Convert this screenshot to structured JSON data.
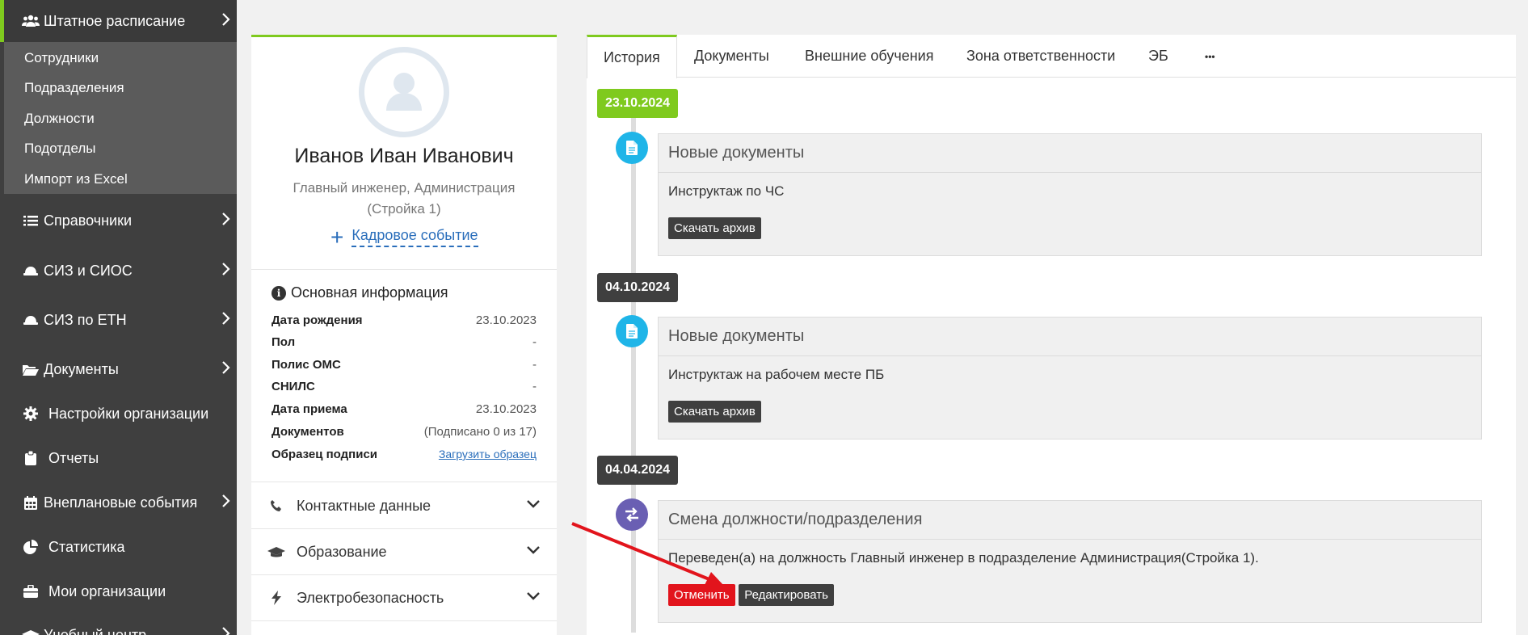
{
  "sidebar": {
    "items": [
      {
        "label": "Штатное расписание",
        "icon": "users-icon"
      },
      {
        "label": "Справочники",
        "icon": "list-icon"
      },
      {
        "label": "СИЗ и СИОС",
        "icon": "helmet-icon"
      },
      {
        "label": "СИЗ по ЕТН",
        "icon": "helmet-icon"
      },
      {
        "label": "Документы",
        "icon": "folder-open-icon"
      },
      {
        "label": "Настройки организации",
        "icon": "gear-icon"
      },
      {
        "label": "Отчеты",
        "icon": "clipboard-icon"
      },
      {
        "label": "Внеплановые события",
        "icon": "calendar-icon"
      },
      {
        "label": "Статистика",
        "icon": "pie-chart-icon"
      },
      {
        "label": "Мои организации",
        "icon": "briefcase-icon"
      },
      {
        "label": "Учебный центр",
        "icon": "graduation-cap-icon"
      }
    ],
    "submenu": [
      "Сотрудники",
      "Подразделения",
      "Должности",
      "Подотделы",
      "Импорт из Excel"
    ]
  },
  "profile": {
    "name": "Иванов Иван Иванович",
    "position": "Главный инженер, Администрация (Стройка 1)",
    "hr_event": "Кадровое событие",
    "info_title": "Основная информация",
    "rows": [
      {
        "k": "Дата рождения",
        "v": "23.10.2023"
      },
      {
        "k": "Пол",
        "v": "-"
      },
      {
        "k": "Полис ОМС",
        "v": "-"
      },
      {
        "k": "СНИЛС",
        "v": "-"
      },
      {
        "k": "Дата приема",
        "v": "23.10.2023"
      },
      {
        "k": "Документов",
        "v": "(Подписано 0 из 17)"
      },
      {
        "k": "Образец подписи",
        "v": "Загрузить образец"
      }
    ],
    "accordions": [
      {
        "label": "Контактные данные",
        "icon": "phone-icon"
      },
      {
        "label": "Образование",
        "icon": "graduation-cap-icon"
      },
      {
        "label": "Электробезопасность",
        "icon": "bolt-icon"
      }
    ]
  },
  "tabs": [
    "История",
    "Документы",
    "Внешние обучения",
    "Зона ответственности",
    "ЭБ",
    "•••"
  ],
  "timeline": [
    {
      "date": "23.10.2024",
      "title": "Новые документы",
      "text": "Инструктаж по ЧС",
      "button": "Скачать архив"
    },
    {
      "date": "04.10.2024",
      "title": "Новые документы",
      "text": "Инструктаж на рабочем месте ПБ",
      "button": "Скачать архив"
    },
    {
      "date": "04.04.2024",
      "title": "Смена должности/подразделения",
      "text": "Переведен(а) на должность Главный инженер в подразделение Администрация(Стройка 1).",
      "cancel": "Отменить",
      "edit": "Редактировать"
    }
  ],
  "colors": {
    "accent": "#7fca1e",
    "sidebar": "#3f3f3f",
    "danger": "#e2141c",
    "link": "#2a6ebb"
  }
}
